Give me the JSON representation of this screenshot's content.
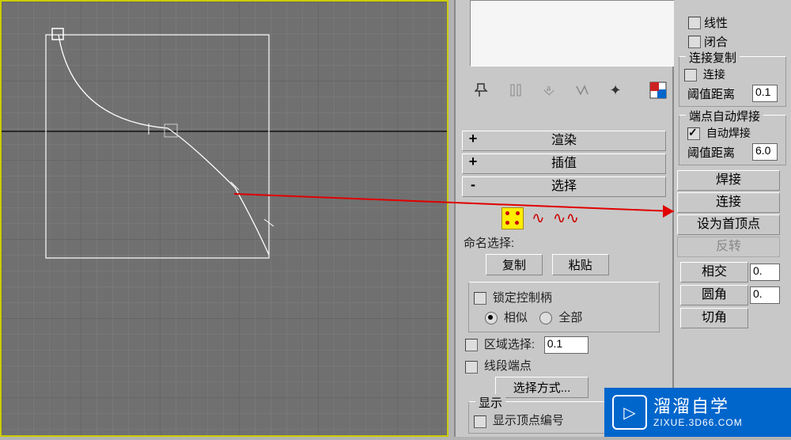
{
  "viewport": {},
  "toolbar_icons": [
    "pin",
    "scissors",
    "pin2",
    "vertex",
    "segment",
    "spline",
    "color"
  ],
  "rollouts": {
    "render": {
      "label": "渲染",
      "state": "+"
    },
    "interp": {
      "label": "插值",
      "state": "+"
    },
    "selection": {
      "label": "选择",
      "state": "-"
    }
  },
  "selection": {
    "named_label": "命名选择:",
    "copy_label": "复制",
    "paste_label": "粘贴",
    "lock_handles_label": "锁定控制柄",
    "similar_label": "相似",
    "all_label": "全部",
    "lock_handles_checked": false,
    "similar_checked": true,
    "all_checked": false,
    "area_select_label": "区域选择:",
    "area_select_value": "0.1",
    "area_select_checked": false,
    "segment_end_label": "线段端点",
    "segment_end_checked": false,
    "select_method_label": "选择方式...",
    "display_label": "显示",
    "show_vertex_num_label": "显示顶点编号",
    "show_vertex_num_checked": false
  },
  "right": {
    "linear_label": "线性",
    "closed_label": "闭合",
    "connect_copy_label": "连接复制",
    "connect_label": "连接",
    "threshold_dist_label": "阈值距离",
    "threshold_dist_value1": "0.1",
    "endpoint_autoweld_label": "端点自动焊接",
    "autoweld_label": "自动焊接",
    "autoweld_checked": true,
    "threshold_dist_value2": "6.0",
    "weld_label": "焊接",
    "connect2_label": "连接",
    "make_first_label": "设为首顶点",
    "reverse_label": "反转",
    "intersect_label": "相交",
    "intersect_value": "0.",
    "fillet_label": "圆角",
    "fillet_value": "0.",
    "chamfer_label": "切角"
  },
  "watermark": {
    "top": "溜溜自学",
    "bottom": "ZIXUE.3D66.COM"
  }
}
